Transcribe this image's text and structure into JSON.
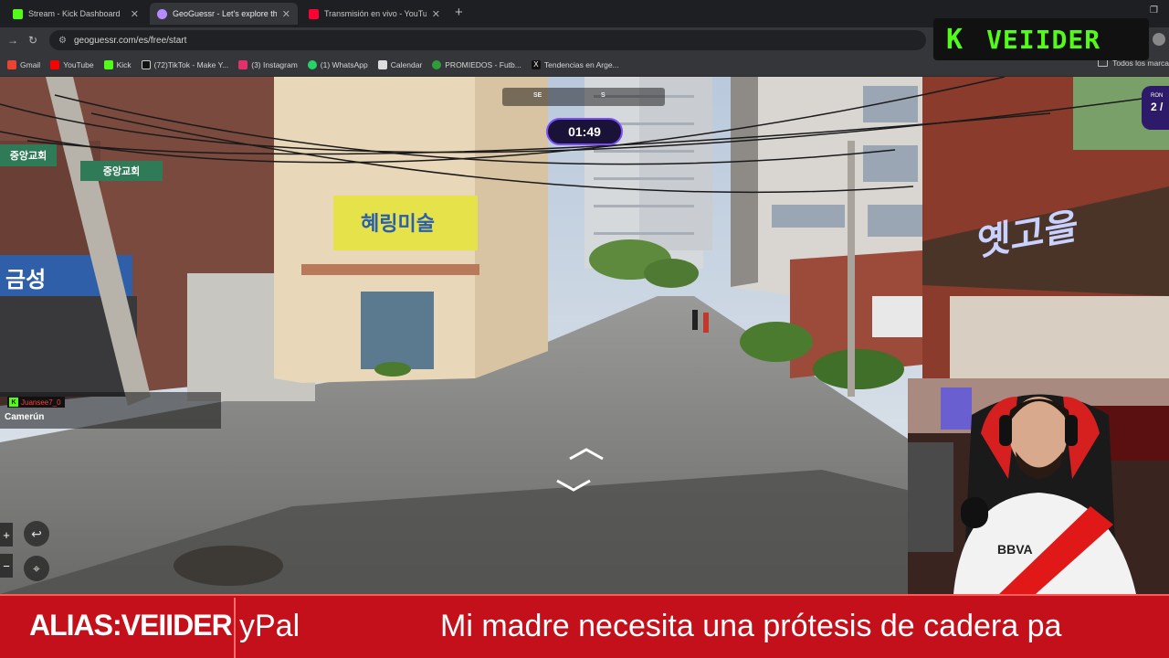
{
  "browser": {
    "tabs": [
      {
        "title": "Stream - Kick Dashboard",
        "favicon_color": "#53fc18",
        "active": false
      },
      {
        "title": "GeoGuessr - Let's explore the w",
        "favicon_color": "#b48cff",
        "active": true
      },
      {
        "title": "Transmisión en vivo - YouTube",
        "favicon_color": "#ff0033",
        "active": false
      }
    ],
    "new_tab": "+",
    "url": "geoguessr.com/es/free/start",
    "bookmarks": [
      {
        "label": "Gmail",
        "color": "#ea4335"
      },
      {
        "label": "YouTube",
        "color": "#ff0000"
      },
      {
        "label": "Kick",
        "color": "#53fc18"
      },
      {
        "label": "(72)TikTok - Make Y...",
        "color": "#ffffff"
      },
      {
        "label": "(3) Instagram",
        "color": "#e1306c"
      },
      {
        "label": "(1) WhatsApp",
        "color": "#25d366"
      },
      {
        "label": "Calendar",
        "color": "#ffffff"
      },
      {
        "label": "PROMIEDOS - Futb...",
        "color": "#2e9d3a"
      },
      {
        "label": "Tendencias en Arge...",
        "color": "#ffffff"
      }
    ],
    "all_bookmarks": "Todos los marca"
  },
  "overlay": {
    "kick_logo_letter": "K",
    "streamer_name": "VEIIDER"
  },
  "game": {
    "timer": "01:49",
    "compass": [
      "SE",
      "S"
    ],
    "score_label": "RON",
    "score_value": "2 /"
  },
  "chat": {
    "username": "Juansee7_0",
    "message": "Camerún"
  },
  "ticker": {
    "alias": "ALIAS:VEIIDER",
    "ypal": "yPal",
    "message": "Mi madre necesita una prótesis de cadera pa"
  },
  "signs": {
    "shop_left": "금성",
    "shop_center": "혜링미술",
    "shop_right": "옛고을",
    "street_sign_1": "중앙교회",
    "street_sign_2": "중앙교회"
  }
}
